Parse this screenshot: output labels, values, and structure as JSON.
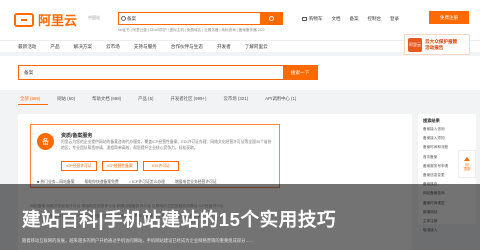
{
  "header": {
    "logo_text": "阿里云",
    "region": "中国站",
    "search_query": "备案",
    "hot_searches": "ssl证书 | 阿里云盘 | DDoS防护 | 虚拟主机 | 免费域名 | 云服务器 | 商标查询 | 备案服务器 2G5",
    "links": [
      "购物车",
      "文档",
      "备案",
      "控制台",
      "登录"
    ],
    "cart_label": "购物车",
    "signup_label": "免费注册"
  },
  "nav": {
    "items": [
      "最新活动",
      "产品",
      "解决方案",
      "云市场",
      "支持与服务",
      "合作伙伴与生态",
      "开发者",
      "了解阿里云"
    ]
  },
  "ad": {
    "logo_text": "阿里云",
    "text_line1": "云大众保护报暂",
    "text_line2": "活动报告"
  },
  "search": {
    "query": "备案",
    "button_label": "搜索一下"
  },
  "tabs": {
    "items": [
      "全部 (869)",
      "网站 (60)",
      "帮助文档 (698)",
      "产品 (6)",
      "开发者社区 (999+)",
      "云市场 (321)",
      "API调用中心 (1)"
    ]
  },
  "card": {
    "icon_label": "备",
    "title": "资质/备案服务",
    "desc": "阿里云为您的企业提供网站的备案咨询代办服务，覆盖ICP经营性备案、EDI许可证办理、网络文化经营许可证等全国30个省份地区，专业团队帮您申请、流程简单高效，帮您提升企业核心竞争力，轻松获取。",
    "buttons": [
      "ICP经营许可证",
      "ICP经营性备案",
      "EDI许可证"
    ],
    "links": [
      "■ 热门业务—网站备案",
      "帮助你快速备案免费",
      "○ ICP许可证怎么办理",
      "增值电信业务经营许可证"
    ]
  },
  "faint_rows": [
    "网站备案   网络文化经营许可证    增值电信业务许可证    网络出版服务许可证    互联网药品信息服务资格证    ICP经营许可证",
    "备案流程   备案服务号申请   ICP备案   网站备案查询   备案核查   PC端   ICP备案流程   备案信息变更   域名备案"
  ],
  "sidebar": {
    "title": "搜索结果",
    "items": [
      "备案接入咨询",
      "备案接入须知",
      "备案时间和流程",
      "首次备案",
      "备案服务号申请",
      "备案信息变更",
      "备案核查",
      "网站备案查询",
      "备案时间规定",
      "新增网站",
      "主体注销",
      "取消接入"
    ]
  },
  "float_button": {
    "label_line1": "回",
    "label_line2": "顶部"
  },
  "overlay": {
    "title": "建站百科|手机站建站的15个实用技巧",
    "subtitle": "随着移动互联网的发展，越来越多的用户开始通过手机访问网站，手机网站建设已经成为企业网络营销的重要组成部分……"
  }
}
